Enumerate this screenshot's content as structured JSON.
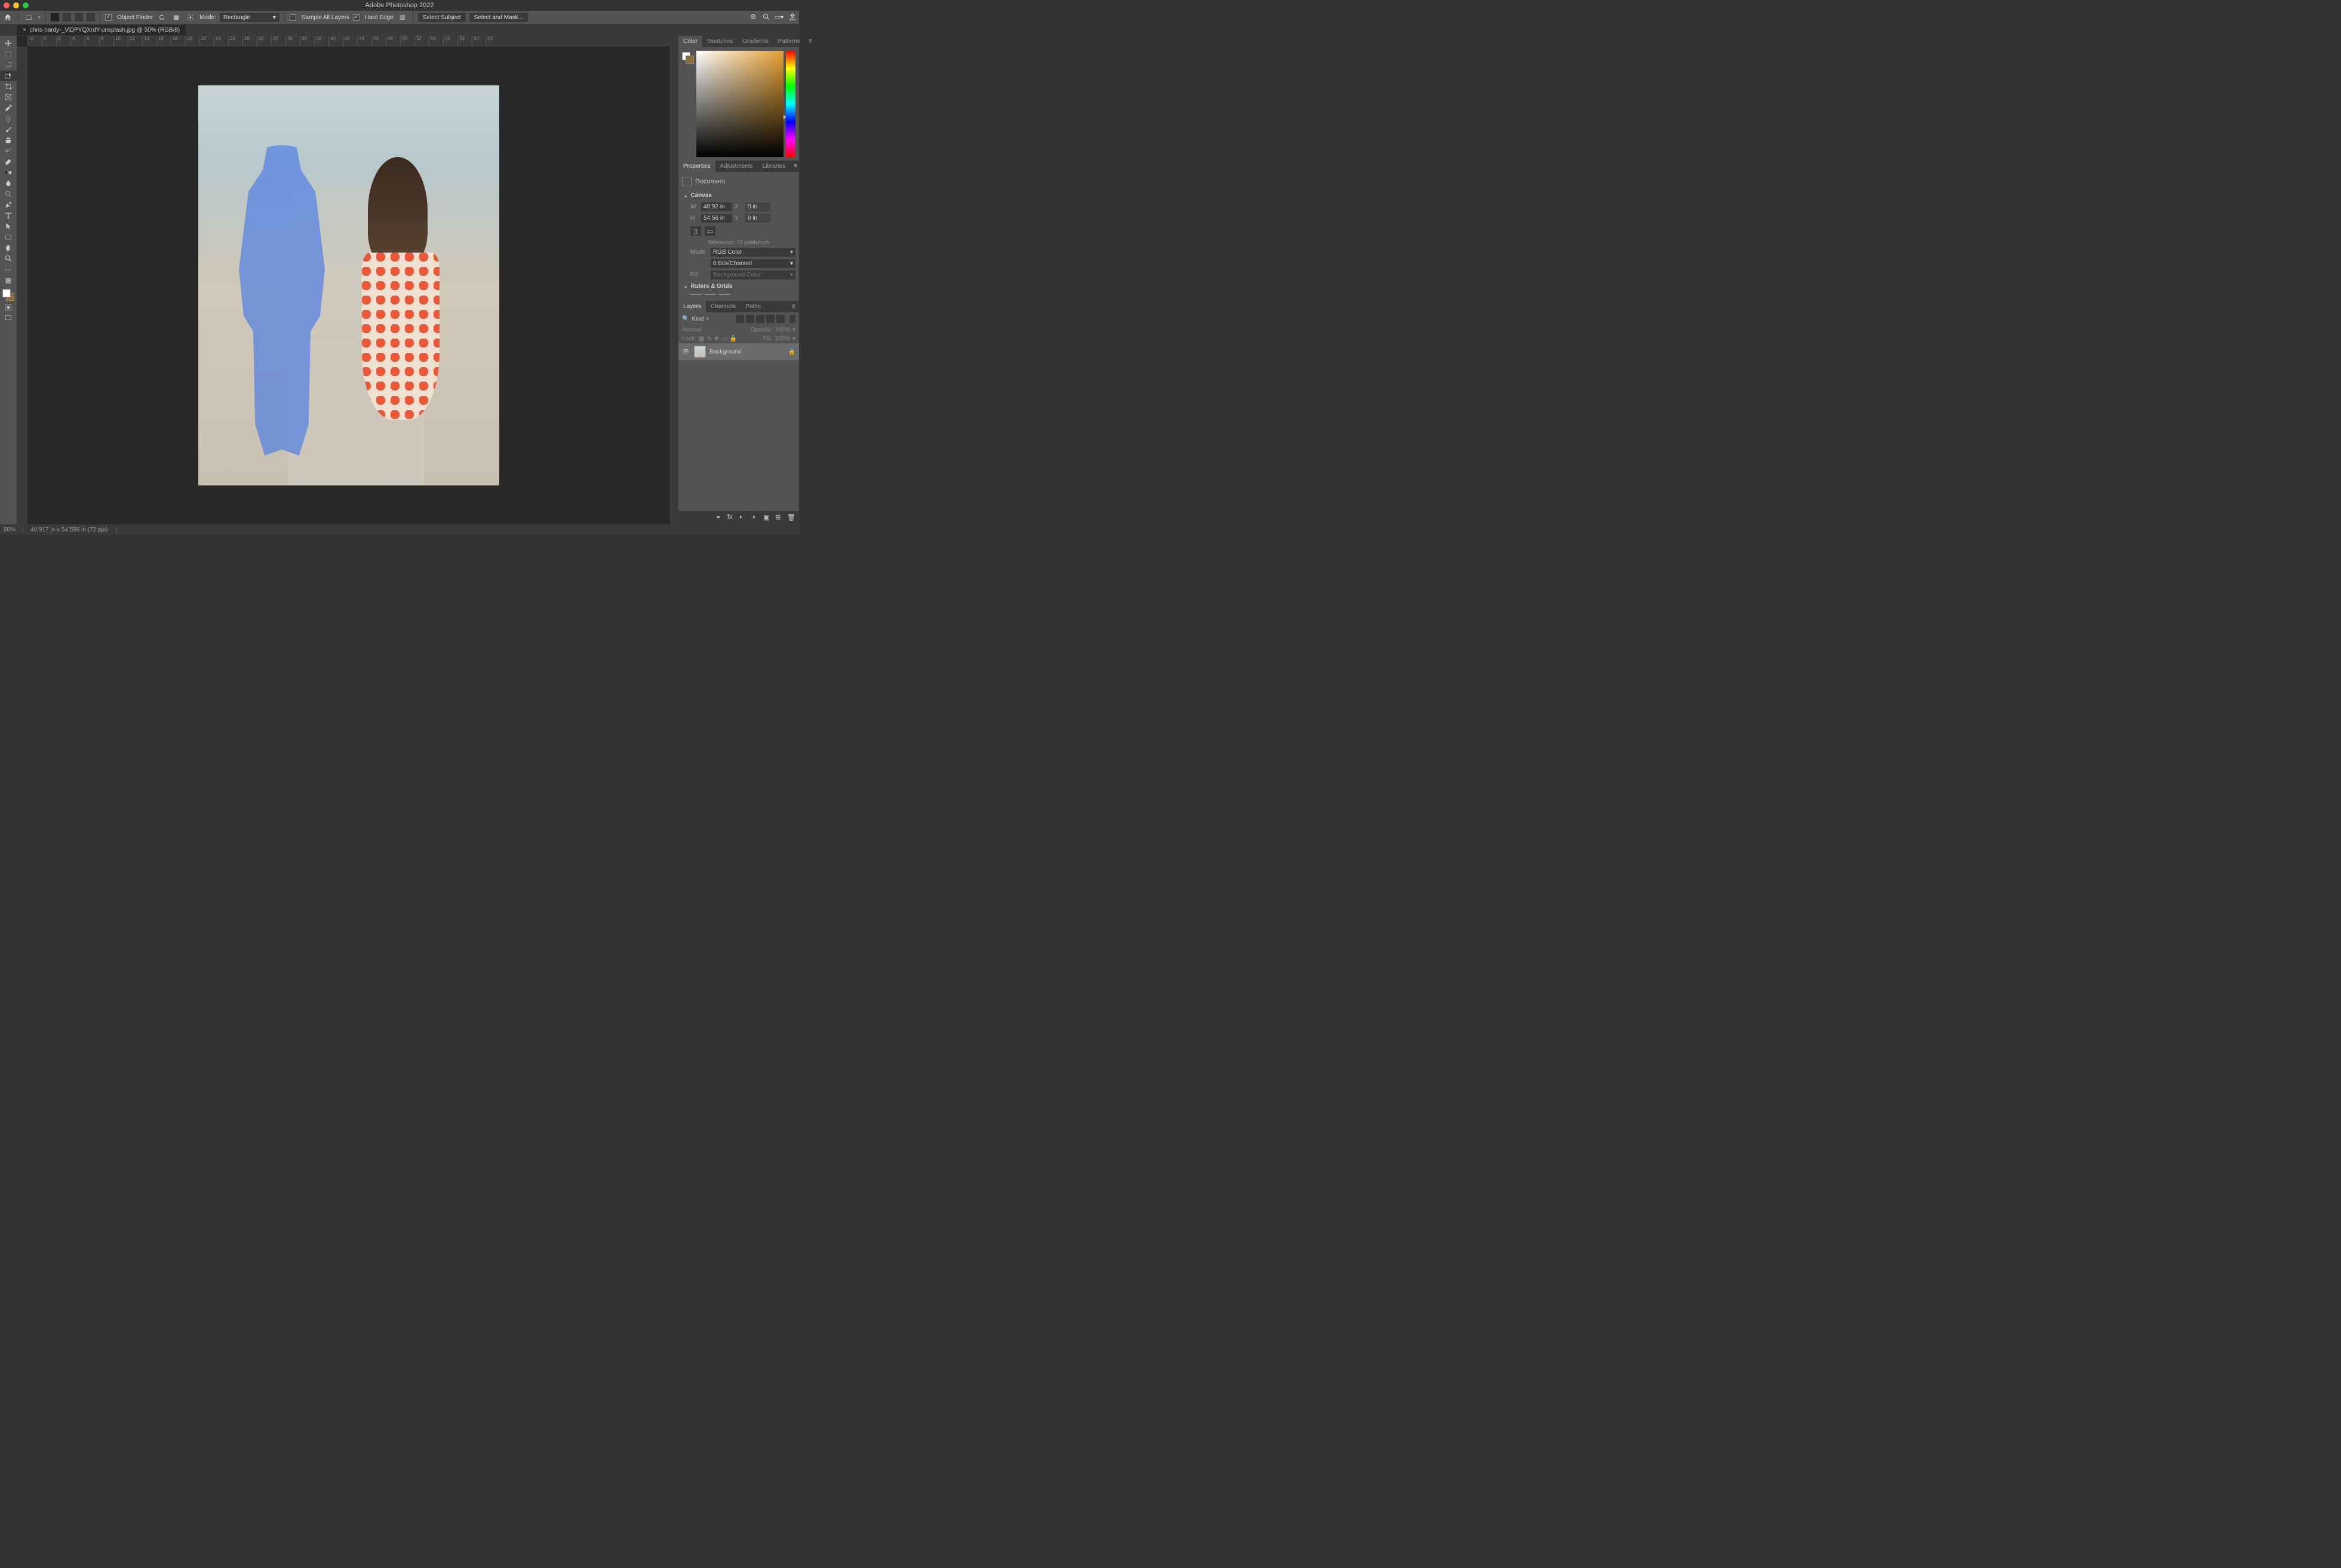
{
  "app_title": "Adobe Photoshop 2022",
  "document": {
    "tab_label": "chris-hardy-_ViDPYQXrdY-unsplash.jpg @ 50% (RGB/8)"
  },
  "options_bar": {
    "object_finder": "Object Finder",
    "mode_label": "Mode:",
    "mode_value": "Rectangle",
    "sample_all": "Sample All Layers",
    "hard_edge": "Hard Edge",
    "select_subject": "Select Subject",
    "select_and_mask": "Select and Mask..."
  },
  "ruler_marks": [
    "-2",
    "0",
    "2",
    "4",
    "6",
    "8",
    "10",
    "12",
    "14",
    "16",
    "18",
    "20",
    "22",
    "24",
    "26",
    "28",
    "30",
    "32",
    "34",
    "36",
    "38",
    "40",
    "42",
    "44",
    "46",
    "48",
    "50",
    "52",
    "54",
    "56",
    "58",
    "60",
    "62"
  ],
  "panels": {
    "color_tabs": [
      "Color",
      "Swatches",
      "Gradients",
      "Patterns"
    ],
    "props_tabs": [
      "Properties",
      "Adjustments",
      "Libraries"
    ],
    "layers_tabs": [
      "Layers",
      "Channels",
      "Paths"
    ]
  },
  "properties": {
    "doc_label": "Document",
    "canvas_label": "Canvas",
    "w_label": "W",
    "w_value": "40.92 in",
    "x_label": "X",
    "x_value": "0 in",
    "h_label": "H",
    "h_value": "54.56 in",
    "y_label": "Y",
    "y_value": "0 in",
    "resolution": "Resolution: 72 pixels/inch",
    "mode_label": "Mode",
    "mode_value": "RGB Color",
    "bits_value": "8 Bits/Channel",
    "fill_label": "Fill",
    "fill_value": "Background Color",
    "rulers_grids": "Rulers & Grids"
  },
  "layers": {
    "kind_label": "Kind",
    "blend_mode": "Normal",
    "opacity_label": "Opacity:",
    "opacity_value": "100%",
    "lock_label": "Lock:",
    "fill_label": "Fill:",
    "fill_value": "100%",
    "layer_name": "Background"
  },
  "status": {
    "zoom": "50%",
    "dims": "40.917 in x 54.556 in (72 ppi)"
  }
}
